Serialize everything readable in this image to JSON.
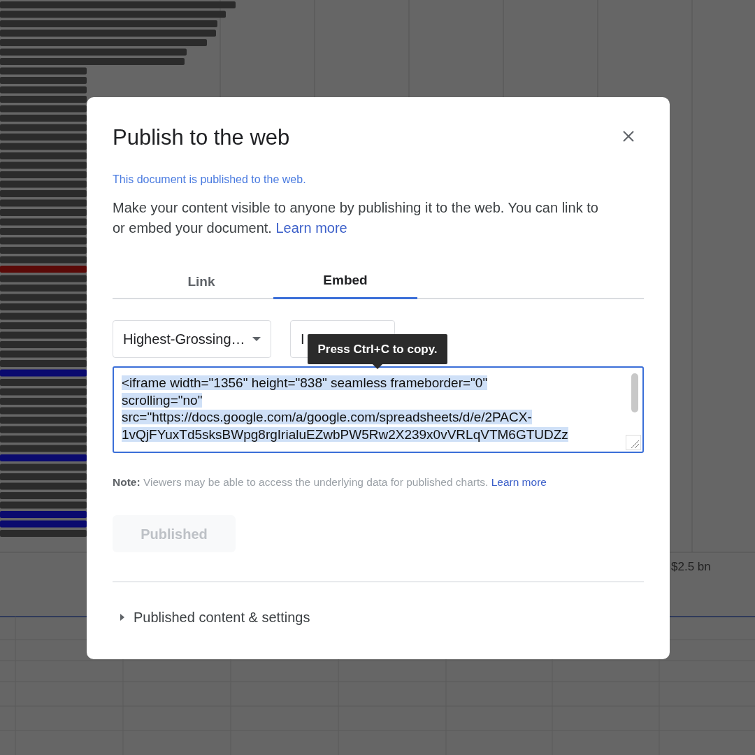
{
  "background": {
    "axis_label": "$2.5 bn"
  },
  "dialog": {
    "title": "Publish to the web",
    "status": "This document is published to the web.",
    "description": "Make your content visible to anyone by publishing it to the web. You can link to or embed your document.",
    "description_link": "Learn more",
    "tabs": [
      {
        "label": "Link",
        "selected": false
      },
      {
        "label": "Embed",
        "selected": true
      }
    ],
    "dropdowns": [
      {
        "value": "Highest-Grossing…"
      },
      {
        "value": "I"
      }
    ],
    "tooltip": "Press Ctrl+C to copy.",
    "code_lines": [
      "<iframe width=\"1356\" height=\"838\" seamless frameborder=\"0\"",
      "scrolling=\"no\"",
      "src=\"https://docs.google.com/a/google.com/spreadsheets/d/e/2PACX-",
      "1vQjFYuxTd5sksBWpg8rgIrialuEZwbPW5Rw2X239x0vVRLqVTM6GTUDZz"
    ],
    "note_label": "Note:",
    "note": "Viewers may be able to access the underlying data for published charts.",
    "note_link": "Learn more",
    "publish_button": {
      "label": "Published",
      "disabled": true
    },
    "section": {
      "label": "Published content & settings",
      "expanded": false
    }
  }
}
